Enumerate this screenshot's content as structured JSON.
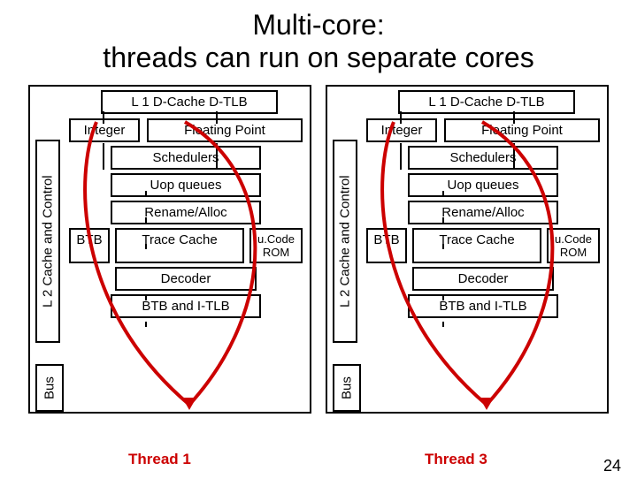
{
  "title_line1": "Multi-core:",
  "title_line2": "threads can run on separate cores",
  "core": {
    "l1": "L 1 D-Cache D-TLB",
    "l2": "L 2 Cache and Control",
    "bus": "Bus",
    "integer": "Integer",
    "fpoint": "Floating Point",
    "sched": "Schedulers",
    "uop": "Uop queues",
    "rename": "Rename/Alloc",
    "btb": "BTB",
    "trace": "Trace Cache",
    "ucode": "u.Code ROM",
    "decoder": "Decoder",
    "btbitlb": "BTB and I-TLB"
  },
  "thread1": "Thread 1",
  "thread3": "Thread 3",
  "pagenum": "24"
}
